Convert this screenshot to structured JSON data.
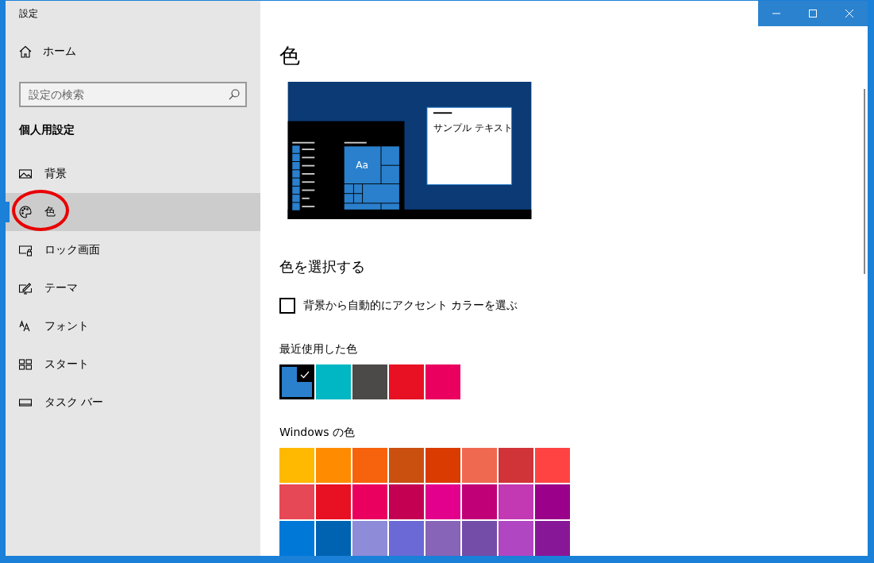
{
  "window": {
    "title": "設定"
  },
  "sidebar": {
    "home": "ホーム",
    "search": {
      "placeholder": "設定の検索"
    },
    "section": "個人用設定",
    "items": [
      {
        "label": "背景",
        "kind": "picture",
        "selected": false,
        "circled": false
      },
      {
        "label": "色",
        "kind": "palette",
        "selected": true,
        "circled": true
      },
      {
        "label": "ロック画面",
        "kind": "lock",
        "selected": false,
        "circled": false
      },
      {
        "label": "テーマ",
        "kind": "theme",
        "selected": false,
        "circled": false
      },
      {
        "label": "フォント",
        "kind": "font",
        "selected": false,
        "circled": false
      },
      {
        "label": "スタート",
        "kind": "start",
        "selected": false,
        "circled": false
      },
      {
        "label": "タスク バー",
        "kind": "taskbar",
        "selected": false,
        "circled": false
      }
    ]
  },
  "page": {
    "title": "色",
    "preview": {
      "tile": "Aa",
      "sample": "サンプル テキスト"
    },
    "choose_heading": "色を選択する",
    "auto_accent": {
      "label": "背景から自動的にアクセント カラーを選ぶ",
      "checked": false
    },
    "recent_heading": "最近使用した色",
    "recent": [
      {
        "color": "#2a80cc",
        "selected": true
      },
      {
        "color": "#00b7c3",
        "selected": false
      },
      {
        "color": "#4c4a48",
        "selected": false
      },
      {
        "color": "#e81123",
        "selected": false
      },
      {
        "color": "#ea005e",
        "selected": false
      }
    ],
    "windows_heading": "Windows の色",
    "windows": [
      {
        "color": "#ffb900",
        "selected": false
      },
      {
        "color": "#ff8c00",
        "selected": false
      },
      {
        "color": "#f7630c",
        "selected": false
      },
      {
        "color": "#ca5010",
        "selected": false
      },
      {
        "color": "#da3b01",
        "selected": false
      },
      {
        "color": "#ef6950",
        "selected": false
      },
      {
        "color": "#d13438",
        "selected": false
      },
      {
        "color": "#ff4343",
        "selected": false
      },
      {
        "color": "#e74856",
        "selected": false
      },
      {
        "color": "#e81123",
        "selected": false
      },
      {
        "color": "#ea005e",
        "selected": false
      },
      {
        "color": "#c30052",
        "selected": false
      },
      {
        "color": "#e3008c",
        "selected": false
      },
      {
        "color": "#bf0077",
        "selected": false
      },
      {
        "color": "#c239b3",
        "selected": false
      },
      {
        "color": "#9a0089",
        "selected": false
      },
      {
        "color": "#0078d7",
        "selected": false
      },
      {
        "color": "#0063b1",
        "selected": false
      },
      {
        "color": "#8e8cd8",
        "selected": false
      },
      {
        "color": "#6b69d6",
        "selected": false
      },
      {
        "color": "#8764b8",
        "selected": false
      },
      {
        "color": "#744da9",
        "selected": false
      },
      {
        "color": "#b146c2",
        "selected": false
      },
      {
        "color": "#881798",
        "selected": false
      }
    ]
  }
}
